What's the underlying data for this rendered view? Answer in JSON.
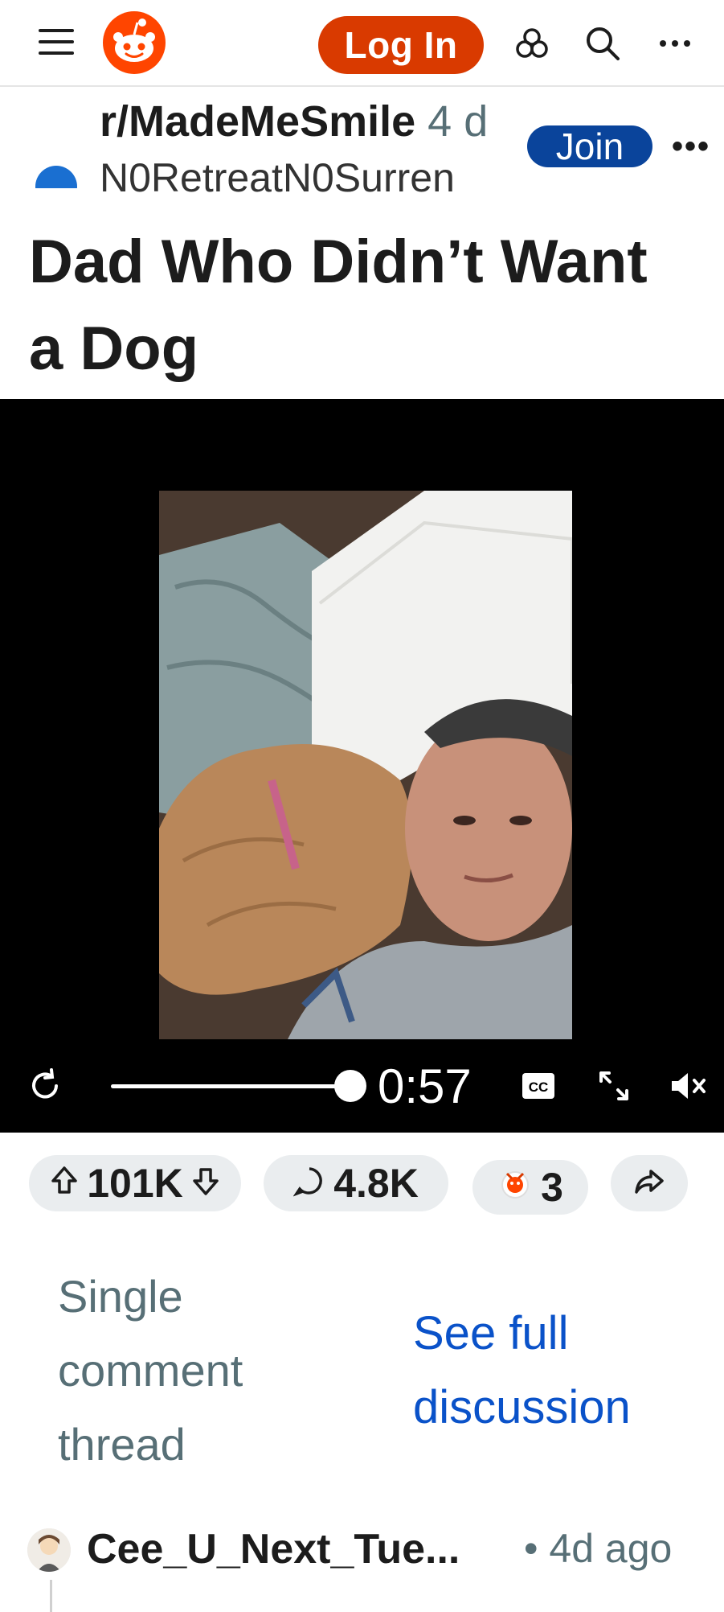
{
  "header": {
    "login_label": "Log In",
    "icons": [
      "menu-icon",
      "reddit-logo",
      "get-app-icon",
      "search-icon",
      "more-icon"
    ],
    "brand_color": "#d93a00"
  },
  "post": {
    "subreddit": "r/MadeMeSmile",
    "age": "4 d",
    "author": "N0RetreatN0Surren",
    "join_label": "Join",
    "title": "Dad Who Didn’t Want a Dog",
    "media": {
      "time_remaining": "0:57",
      "progress": 0.98,
      "cc_label": "CC"
    },
    "actions": {
      "upvotes": "101K",
      "comments": "4.8K",
      "awards": "3"
    }
  },
  "thread": {
    "single_label": "Single comment thread",
    "see_full_label": "See full discussion"
  },
  "comment": {
    "author": "Cee_U_Next_Tue...",
    "age": "• 4d ago"
  }
}
